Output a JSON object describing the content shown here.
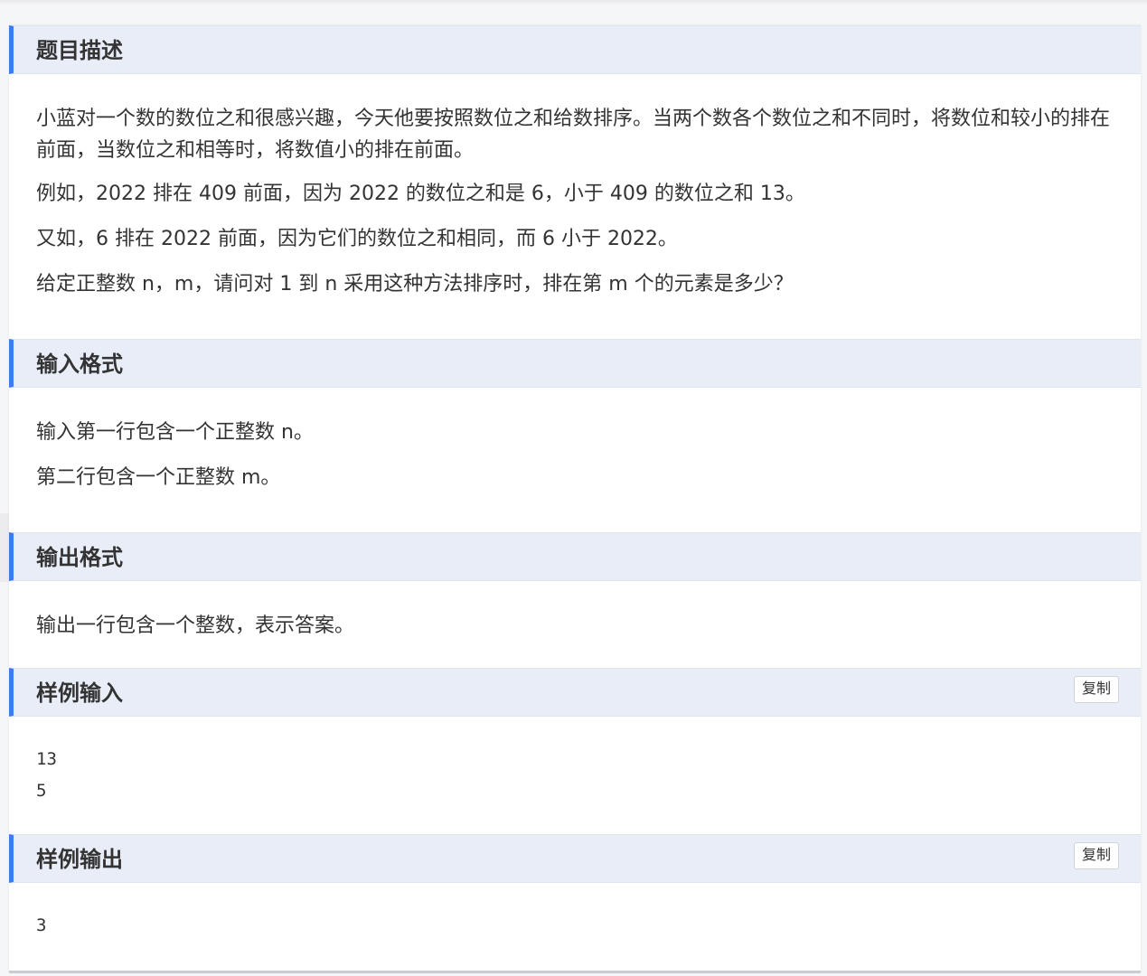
{
  "description": {
    "title": "题目描述",
    "paragraphs": [
      "小蓝对一个数的数位之和很感兴趣，今天他要按照数位之和给数排序。当两个数各个数位之和不同时，将数位和较小的排在前面，当数位之和相等时，将数值小的排在前面。",
      "例如，2022 排在 409 前面，因为 2022 的数位之和是 6，小于 409 的数位之和 13。",
      "又如，6 排在 2022 前面，因为它们的数位之和相同，而 6 小于 2022。",
      "给定正整数 n，m，请问对 1 到 n 采用这种方法排序时，排在第 m 个的元素是多少？"
    ]
  },
  "input_format": {
    "title": "输入格式",
    "paragraphs": [
      "输入第一行包含一个正整数 n。",
      "第二行包含一个正整数 m。"
    ]
  },
  "output_format": {
    "title": "输出格式",
    "paragraphs": [
      "输出一行包含一个整数，表示答案。"
    ]
  },
  "sample_input": {
    "title": "样例输入",
    "copy_label": "复制",
    "lines": [
      "13",
      "5"
    ]
  },
  "sample_output": {
    "title": "样例输出",
    "copy_label": "复制",
    "lines": [
      "3"
    ]
  },
  "colors": {
    "accent": "#3f7bf0",
    "header_bg": "#e8edf8"
  }
}
